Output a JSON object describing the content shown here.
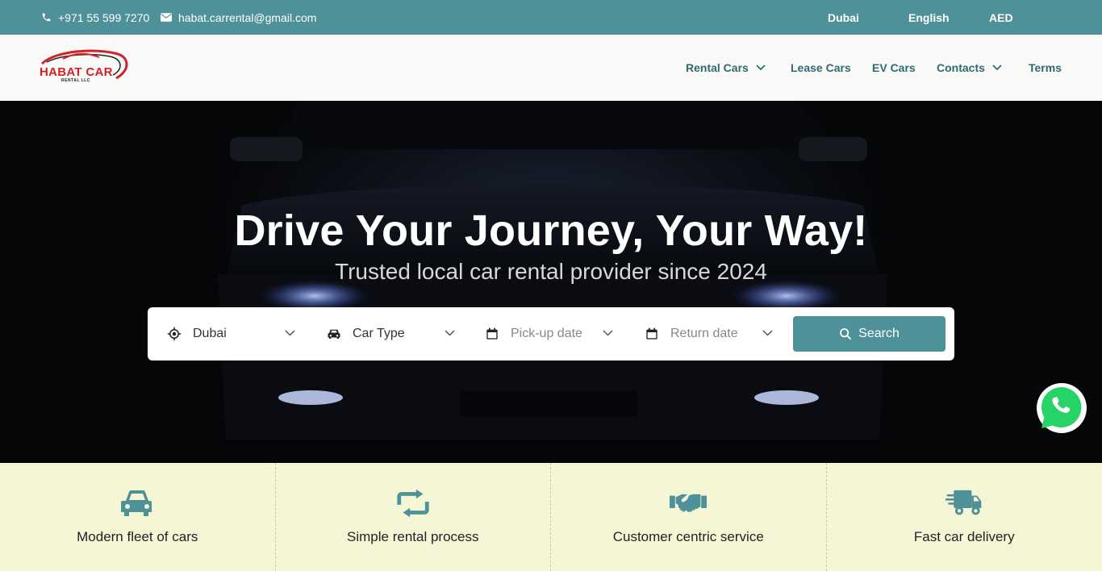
{
  "topbar": {
    "phone": "+971 55 599 7270",
    "email": "habat.carrental@gmail.com",
    "city": "Dubai",
    "language": "English",
    "currency": "AED"
  },
  "header": {
    "logo_text": "HABAT CAR",
    "logo_sub": "RENTAL LLC",
    "nav": {
      "rental_cars": "Rental Cars",
      "lease_cars": "Lease Cars",
      "ev_cars": "EV Cars",
      "contacts": "Contacts",
      "terms": "Terms"
    }
  },
  "hero": {
    "title": "Drive Your Journey, Your Way!",
    "subtitle": "Trusted local car rental provider since 2024",
    "search": {
      "city_value": "Dubai",
      "car_type_placeholder": "Car Type",
      "pickup_placeholder": "Pick-up date",
      "return_placeholder": "Return date",
      "button_label": "Search"
    }
  },
  "features": [
    {
      "label": "Modern fleet of cars",
      "icon": "car-icon"
    },
    {
      "label": "Simple rental process",
      "icon": "repeat-icon"
    },
    {
      "label": "Customer centric service",
      "icon": "handshake-icon"
    },
    {
      "label": "Fast car delivery",
      "icon": "delivery-truck-icon"
    }
  ],
  "colors": {
    "accent": "#4f9199",
    "nav_text": "#2f6a73",
    "feature_bg": "#f4f6d5",
    "logo_red": "#d32227",
    "whatsapp_green": "#25d366"
  }
}
